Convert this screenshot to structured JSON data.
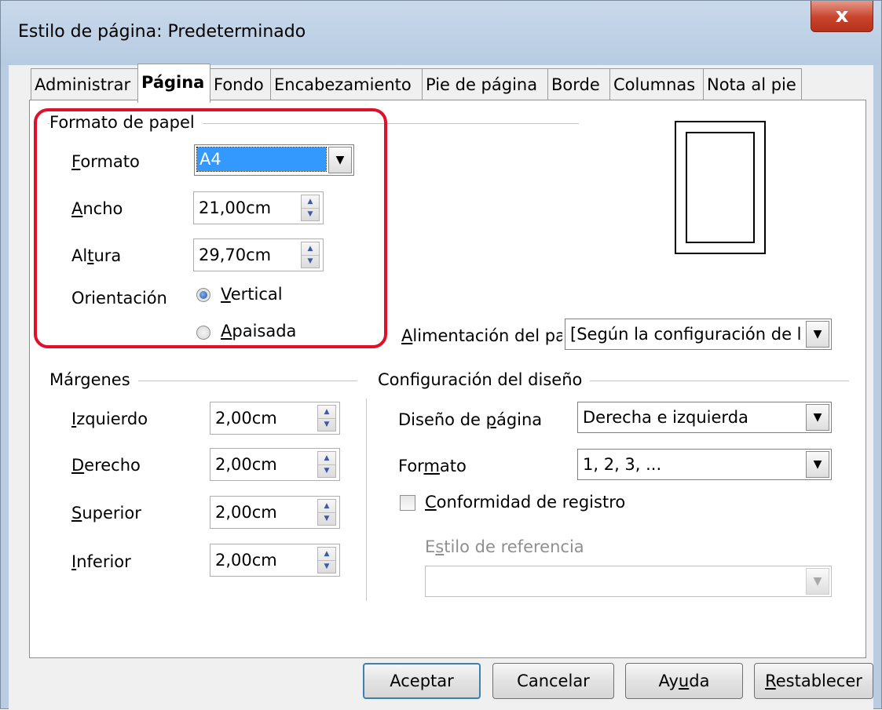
{
  "window": {
    "title": "Estilo de página: Predeterminado",
    "close_glyph": "x"
  },
  "tabs": [
    {
      "label": "Administrar"
    },
    {
      "label": "Página"
    },
    {
      "label": "Fondo"
    },
    {
      "label": "Encabezamiento"
    },
    {
      "label": "Pie de página"
    },
    {
      "label": "Borde"
    },
    {
      "label": "Columnas"
    },
    {
      "label": "Nota al pie"
    }
  ],
  "active_tab": "Página",
  "paper_format": {
    "group_title": "Formato de papel",
    "format": {
      "label_pre": "",
      "label_u": "F",
      "label_post": "ormato",
      "value": "A4"
    },
    "width": {
      "label_pre": "",
      "label_u": "A",
      "label_post": "ncho",
      "value": "21,00cm"
    },
    "height": {
      "label_pre": "Al",
      "label_u": "t",
      "label_post": "ura",
      "value": "29,70cm"
    },
    "orientation": {
      "label": "Orientación",
      "portrait": {
        "label_pre": "",
        "label_u": "V",
        "label_post": "ertical",
        "selected": true
      },
      "landscape": {
        "label_pre": "",
        "label_u": "A",
        "label_post": "paisada",
        "selected": false
      }
    }
  },
  "paper_tray": {
    "label_pre": "",
    "label_u": "A",
    "label_post": "limentación del pa",
    "value": "[Según la configuración de l"
  },
  "margins": {
    "group_title": "Márgenes",
    "left": {
      "label_pre": "",
      "label_u": "I",
      "label_post": "zquierdo",
      "value": "2,00cm"
    },
    "right": {
      "label_pre": "",
      "label_u": "D",
      "label_post": "erecho",
      "value": "2,00cm"
    },
    "top": {
      "label_pre": "",
      "label_u": "S",
      "label_post": "uperior",
      "value": "2,00cm"
    },
    "bottom": {
      "label_pre": "",
      "label_u": "I",
      "label_post": "nferior",
      "value": "2,00cm"
    }
  },
  "layout_settings": {
    "group_title": "Configuración del diseño",
    "page_layout": {
      "label_pre": "Diseño de ",
      "label_u": "p",
      "label_post": "ágina",
      "value": "Derecha e izquierda"
    },
    "format": {
      "label_pre": "For",
      "label_u": "m",
      "label_post": "ato",
      "value": "1, 2, 3, ..."
    },
    "register_true": {
      "label_pre": "",
      "label_u": "C",
      "label_post": "onformidad de registro",
      "checked": false
    },
    "reference_style": {
      "label_pre": "E",
      "label_u": "s",
      "label_post": "tilo de referencia",
      "value": ""
    }
  },
  "buttons": {
    "ok": {
      "label_pre": "Aceptar",
      "label_u": "",
      "label_post": ""
    },
    "cancel": {
      "label_pre": "Cancelar",
      "label_u": "",
      "label_post": ""
    },
    "help": {
      "label_pre": "Ay",
      "label_u": "u",
      "label_post": "da"
    },
    "reset": {
      "label_pre": "",
      "label_u": "R",
      "label_post": "establecer"
    }
  },
  "colors": {
    "highlight": "#e0102a",
    "selection": "#3399ff",
    "default_button_border": "#3c7fb1"
  },
  "icons": {
    "close": "close-icon",
    "spin": "spin-up-down-icon",
    "dropdown": "chevron-down-icon",
    "radio": "radio-icon",
    "checkbox": "checkbox-icon"
  }
}
